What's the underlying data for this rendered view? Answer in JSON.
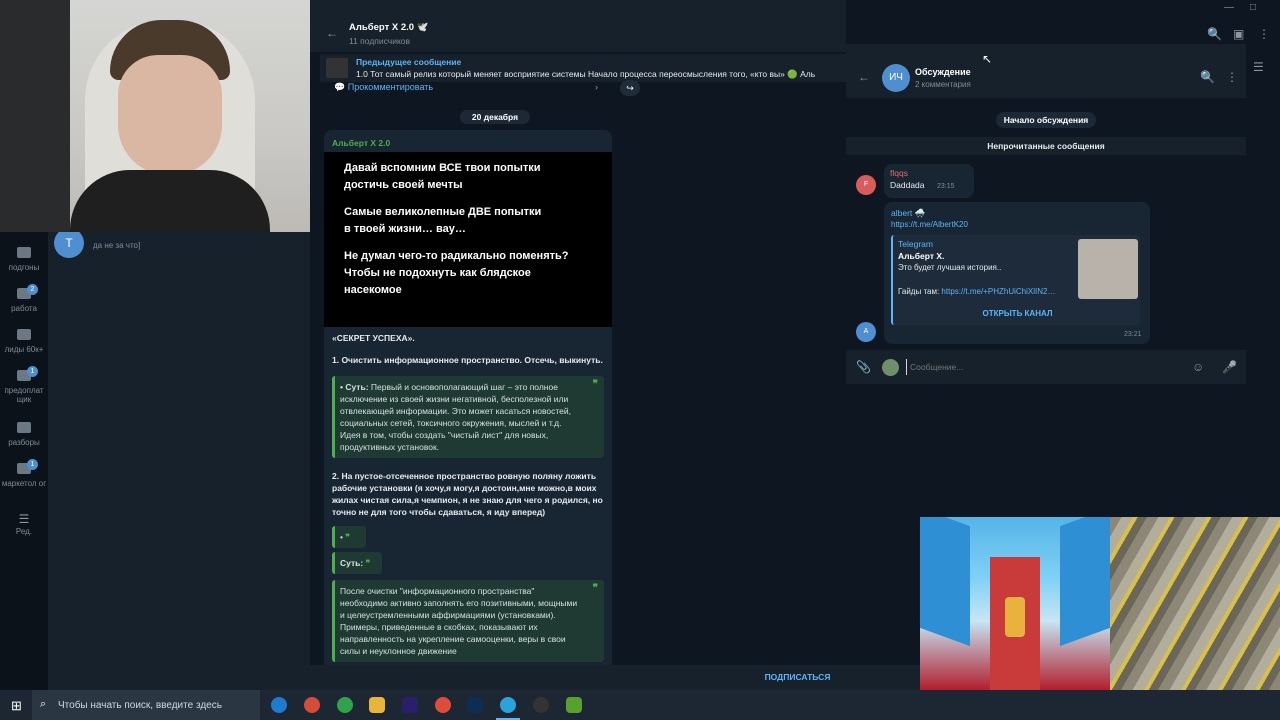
{
  "folders": [
    {
      "label": "подгоны",
      "badge": ""
    },
    {
      "label": "работа",
      "badge": "2"
    },
    {
      "label": "лиды 60к+",
      "badge": ""
    },
    {
      "label": "предоплат щик",
      "badge": "1"
    },
    {
      "label": "разборы",
      "badge": ""
    },
    {
      "label": "маркетол ог",
      "badge": "1"
    },
    {
      "label": "Ред.",
      "badge": ""
    }
  ],
  "chatlist": {
    "avatar_letter": "T",
    "preview": "да не за что]"
  },
  "channel": {
    "title": "Альберт X 2.0 🕊️",
    "subscribers": "11 подписчиков",
    "pinned_title": "Предыдущее сообщение",
    "pinned_text": "1.0   Тот самый релиз который меняет восприятие системы   Начало процесса переосмысления того, «кто вы»   🟢 Аль",
    "comment_link": "Прокомментировать",
    "date": "20 декабря",
    "subscribe": "ПОДПИСАТЬСЯ"
  },
  "post": {
    "author": "Альберт X 2.0",
    "image_lines": [
      "Давай вспомним ВСЕ твои попытки",
      "достичь своей мечты",
      "",
      "Самые великолепные ДВЕ попытки",
      "в твоей жизни… вау…",
      "",
      "Не думал чего-то радикально поменять?",
      "Чтобы не подохнуть как блядское",
      "насекомое"
    ],
    "secret": "«СЕКРЕТ УСПЕХА».",
    "item1": "1. Очистить информационное пространство. Отсечь, выкинуть.",
    "quote1_bold": "• Суть:",
    "quote1": "Первый и основополагающий шаг – это полное исключение из своей жизни негативной, бесполезной или отвлекающей информации. Это может касаться новостей, социальных сетей, токсичного окружения, мыслей и т.д. Идея в том, чтобы создать \"чистый лист\" для новых, продуктивных установок.",
    "item2": "2. На пустое-отсеченное пространство ровную поляну ложить рабочие установки (я хочу,я могу,я достоин,мне можно,в моих жилах чистая сила,я чемпион, я не знаю для чего я родился, но точно не для того чтобы сдаваться, я иду вперед)",
    "quote2": "•",
    "quote3": "Суть:",
    "quote4": "После очистки \"информационного пространства\" необходимо активно заполнять его позитивными, мощными и целеустремленными аффирмациями (установками). Примеры, приведенные в скобках, показывают их направленность на укрепление самооценки, веры в свои силы и неуклонное движение"
  },
  "comments": {
    "avatar_initials": "ИЧ",
    "title": "Обсуждение",
    "count": "2 комментария",
    "start_label": "Начало обсуждения",
    "unread_label": "Непрочитанные сообщения",
    "msg1_avatar": "F",
    "msg1_author": "flqqs",
    "msg1_text": "Daddada",
    "msg1_time": "23:15",
    "msg2_author": "albert 🌨️",
    "msg2_link": "https://t.me/AlbertK20",
    "preview_site": "Telegram",
    "preview_title": "Альберт X.",
    "preview_desc": "Это будет лучшая история..",
    "preview_guides_label": "Гайды там:",
    "preview_guides_link": "https://t.me/+PHZhUiChiXlIN2…",
    "open_channel": "ОТКРЫТЬ КАНАЛ",
    "msg2_time": "23:21",
    "msg2_avatar": "A",
    "input_placeholder": "Сообщение..."
  },
  "taskbar": {
    "search_placeholder": "Чтобы начать поиск, введите здесь"
  },
  "colors": {
    "accent": "#5eb5f7",
    "green": "#4fae4e",
    "bg": "#0e1621",
    "panel": "#17212b"
  }
}
